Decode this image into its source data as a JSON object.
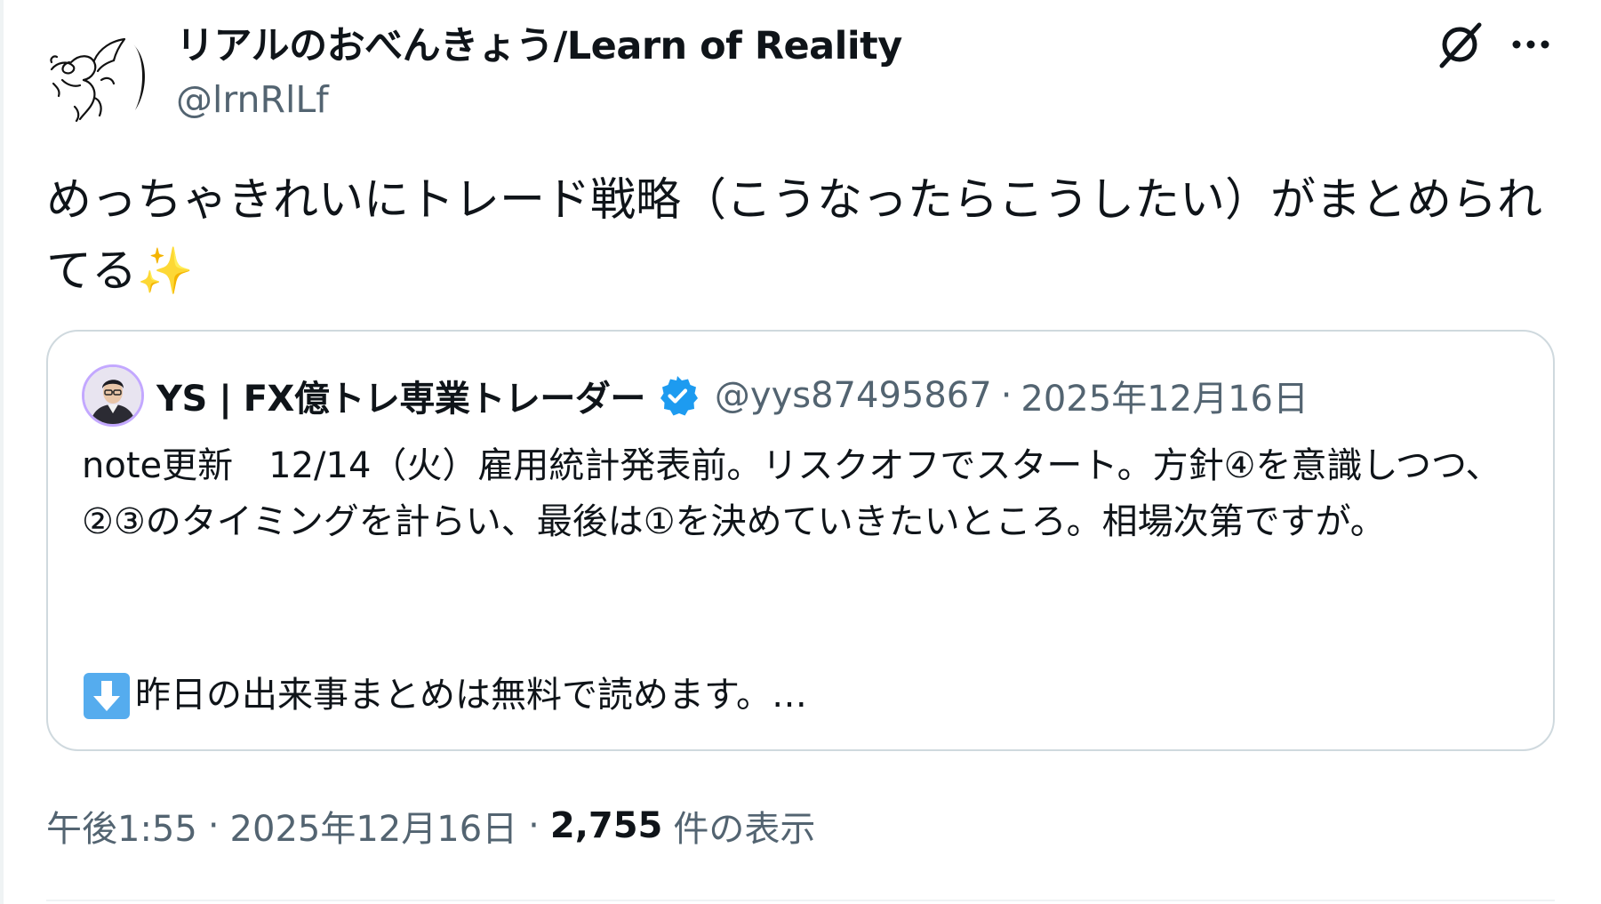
{
  "tweet": {
    "author": {
      "name": "リアルのおべんきょう/Learn of Reality",
      "handle": "@lrnRlLf"
    },
    "text": "めっちゃきれいにトレード戦略（こうなったらこうしたい）がまとめられてる✨",
    "quote": {
      "author_name": "YS | FX億トレ専業トレーダー",
      "verified": true,
      "handle": "@yys87495867",
      "separator": "·",
      "date": "2025年12月16日",
      "text": "note更新　12/14（火）雇用統計発表前。リスクオフでスタート。方針④を意識しつつ、②③のタイミングを計らい、最後は①を決めていきたいところ。相場次第ですが。",
      "text_more": "昨日の出来事まとめは無料で読めます。…",
      "icon_down_arrow": "down-arrow-icon"
    },
    "meta": {
      "time": "午後1:55",
      "separator": "·",
      "date": "2025年12月16日",
      "views_count": "2,755",
      "views_label": "件の表示"
    }
  },
  "icons": {
    "grok": "grok-icon",
    "more": "more-icon",
    "verified": "verified-badge-icon"
  },
  "colors": {
    "text_primary": "#0f1419",
    "text_secondary": "#536471",
    "border": "#cfd9de",
    "verified_blue": "#1d9bf0"
  }
}
